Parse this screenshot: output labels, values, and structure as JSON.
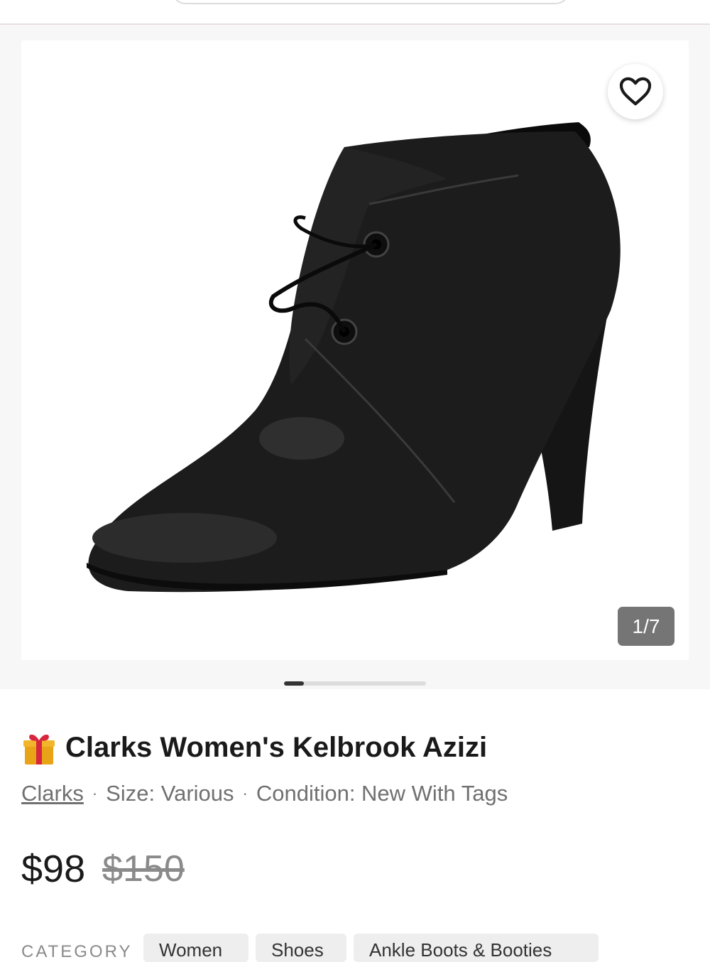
{
  "listing": {
    "title": "Clarks Women's Kelbrook Azizi",
    "brand": "Clarks",
    "size": "Size: Various",
    "condition": "Condition: New With Tags",
    "price": "$98",
    "original_price": "$150",
    "title_icon": "gift-icon"
  },
  "gallery": {
    "counter": "1/7",
    "current": 1,
    "total": 7,
    "favorite_icon": "heart-icon",
    "progress": 0.14
  },
  "category": {
    "label": "CATEGORY",
    "chips": [
      "Women",
      "Shoes",
      "Ankle Boots & Booties"
    ]
  },
  "colors": {
    "counter_bg": "#757575",
    "progress_fill": "#333333",
    "progress_track": "#dddddd",
    "text_primary": "#1a1a1a",
    "text_secondary": "#707070"
  }
}
